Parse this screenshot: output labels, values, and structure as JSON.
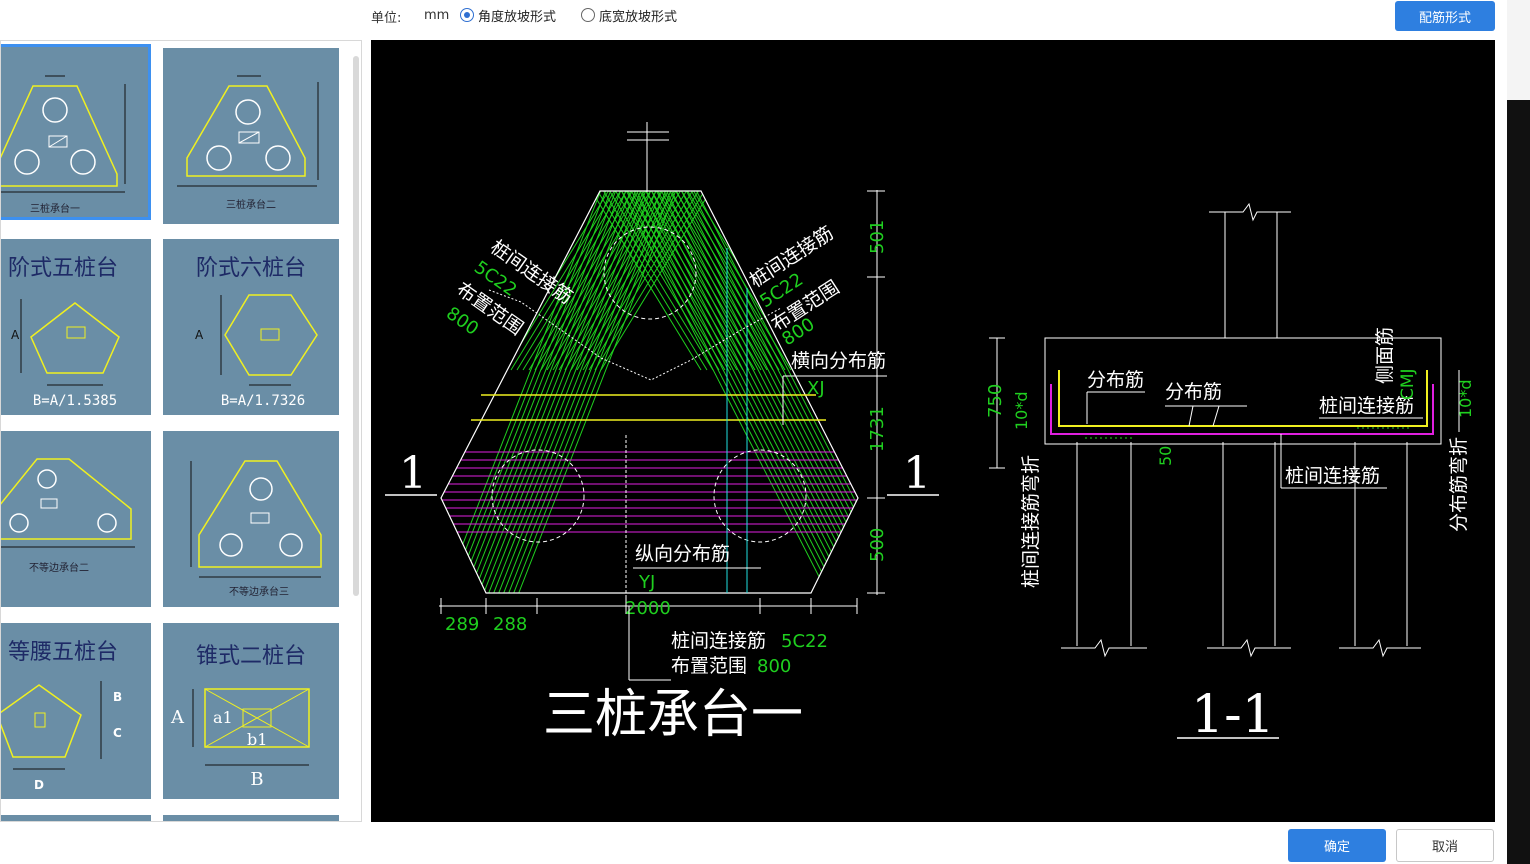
{
  "toolbar": {
    "unit_label": "单位:",
    "unit_value": "mm",
    "radio_options": [
      {
        "label": "角度放坡形式",
        "selected": true
      },
      {
        "label": "底宽放坡形式",
        "selected": false
      }
    ],
    "rebar_form_button": "配筋形式"
  },
  "gallery": {
    "items": [
      {
        "caption": "三桩承台一",
        "selected": true
      },
      {
        "caption": "三桩承台二",
        "selected": false
      },
      {
        "caption": "阶式五桩台",
        "formula": "B=A/1.5385",
        "selected": false
      },
      {
        "caption": "阶式六桩台",
        "formula": "B=A/1.7326",
        "selected": false
      },
      {
        "caption": "不等边承台二",
        "selected": false
      },
      {
        "caption": "不等边承台三",
        "selected": false
      },
      {
        "caption": "等腰五桩台",
        "selected": false
      },
      {
        "caption": "锥式二桩台",
        "selected": false
      }
    ],
    "thumb_labels": {
      "dim_a": "A",
      "dim_b": "B",
      "dim_c": "C",
      "dim_d": "D",
      "a1": "a1",
      "b1": "b1"
    }
  },
  "drawing": {
    "title_left": "三桩承台一",
    "title_right": "1-1",
    "section_mark": "1",
    "plan": {
      "upper_left_bar_name": "桩间连接筋",
      "upper_left_bar_spec": "5C22",
      "upper_left_range_label": "布置范围",
      "upper_left_range_value": "800",
      "upper_right_bar_name": "桩间连接筋",
      "upper_right_bar_spec": "5C22",
      "upper_right_range_label": "布置范围",
      "upper_right_range_value": "800",
      "transverse_label": "横向分布筋",
      "transverse_code": "XJ",
      "longitudinal_label": "纵向分布筋",
      "longitudinal_code": "YJ",
      "bottom_bar_name": "桩间连接筋",
      "bottom_bar_spec": "5C22",
      "bottom_range_label": "布置范围",
      "bottom_range_value": "800",
      "dim_top": "501",
      "dim_mid": "1731",
      "dim_bottom": "500",
      "dim_width": "2000",
      "dim_left1": "289",
      "dim_left2": "288"
    },
    "section": {
      "dist_bar_1": "分布筋",
      "dist_bar_2": "分布筋",
      "side_bar": "侧面筋",
      "side_code": "CMJ",
      "link_bar_1": "桩间连接筋",
      "link_bar_2": "桩间连接筋",
      "left_vertical": "桩间连接筋弯折",
      "right_vertical": "分布筋弯折",
      "hook_left": "10*d",
      "hook_right": "10*d",
      "dim_height": "750",
      "dim_embed": "50"
    }
  },
  "footer": {
    "ok_button": "确定",
    "cancel_button": "取消"
  },
  "colors": {
    "primary": "#2e7fe0",
    "thumb_bg": "#6a8ea6",
    "cad_green": "#1fcf1f",
    "cad_magenta": "#e020e0",
    "cad_yellow": "#f0f020",
    "cad_cyan": "#20e0e0"
  }
}
